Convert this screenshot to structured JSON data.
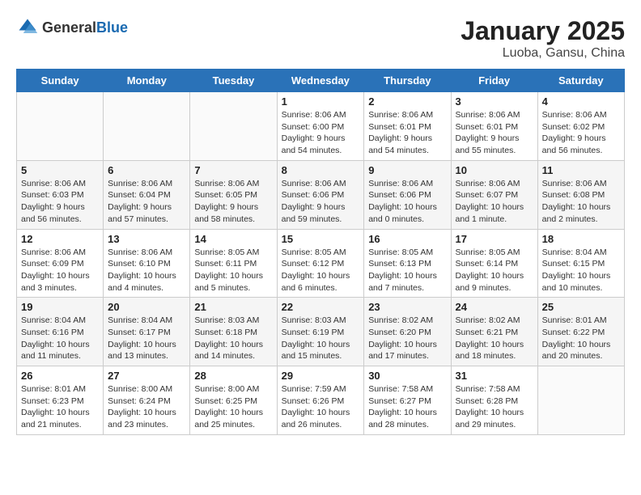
{
  "header": {
    "logo_general": "General",
    "logo_blue": "Blue",
    "month": "January 2025",
    "location": "Luoba, Gansu, China"
  },
  "days_of_week": [
    "Sunday",
    "Monday",
    "Tuesday",
    "Wednesday",
    "Thursday",
    "Friday",
    "Saturday"
  ],
  "weeks": [
    {
      "days": [
        {
          "number": "",
          "empty": true
        },
        {
          "number": "",
          "empty": true
        },
        {
          "number": "",
          "empty": true
        },
        {
          "number": "1",
          "sunrise": "8:06 AM",
          "sunset": "6:00 PM",
          "daylight": "9 hours and 54 minutes."
        },
        {
          "number": "2",
          "sunrise": "8:06 AM",
          "sunset": "6:01 PM",
          "daylight": "9 hours and 54 minutes."
        },
        {
          "number": "3",
          "sunrise": "8:06 AM",
          "sunset": "6:01 PM",
          "daylight": "9 hours and 55 minutes."
        },
        {
          "number": "4",
          "sunrise": "8:06 AM",
          "sunset": "6:02 PM",
          "daylight": "9 hours and 56 minutes."
        }
      ]
    },
    {
      "days": [
        {
          "number": "5",
          "sunrise": "8:06 AM",
          "sunset": "6:03 PM",
          "daylight": "9 hours and 56 minutes."
        },
        {
          "number": "6",
          "sunrise": "8:06 AM",
          "sunset": "6:04 PM",
          "daylight": "9 hours and 57 minutes."
        },
        {
          "number": "7",
          "sunrise": "8:06 AM",
          "sunset": "6:05 PM",
          "daylight": "9 hours and 58 minutes."
        },
        {
          "number": "8",
          "sunrise": "8:06 AM",
          "sunset": "6:06 PM",
          "daylight": "9 hours and 59 minutes."
        },
        {
          "number": "9",
          "sunrise": "8:06 AM",
          "sunset": "6:06 PM",
          "daylight": "10 hours and 0 minutes."
        },
        {
          "number": "10",
          "sunrise": "8:06 AM",
          "sunset": "6:07 PM",
          "daylight": "10 hours and 1 minute."
        },
        {
          "number": "11",
          "sunrise": "8:06 AM",
          "sunset": "6:08 PM",
          "daylight": "10 hours and 2 minutes."
        }
      ]
    },
    {
      "days": [
        {
          "number": "12",
          "sunrise": "8:06 AM",
          "sunset": "6:09 PM",
          "daylight": "10 hours and 3 minutes."
        },
        {
          "number": "13",
          "sunrise": "8:06 AM",
          "sunset": "6:10 PM",
          "daylight": "10 hours and 4 minutes."
        },
        {
          "number": "14",
          "sunrise": "8:05 AM",
          "sunset": "6:11 PM",
          "daylight": "10 hours and 5 minutes."
        },
        {
          "number": "15",
          "sunrise": "8:05 AM",
          "sunset": "6:12 PM",
          "daylight": "10 hours and 6 minutes."
        },
        {
          "number": "16",
          "sunrise": "8:05 AM",
          "sunset": "6:13 PM",
          "daylight": "10 hours and 7 minutes."
        },
        {
          "number": "17",
          "sunrise": "8:05 AM",
          "sunset": "6:14 PM",
          "daylight": "10 hours and 9 minutes."
        },
        {
          "number": "18",
          "sunrise": "8:04 AM",
          "sunset": "6:15 PM",
          "daylight": "10 hours and 10 minutes."
        }
      ]
    },
    {
      "days": [
        {
          "number": "19",
          "sunrise": "8:04 AM",
          "sunset": "6:16 PM",
          "daylight": "10 hours and 11 minutes."
        },
        {
          "number": "20",
          "sunrise": "8:04 AM",
          "sunset": "6:17 PM",
          "daylight": "10 hours and 13 minutes."
        },
        {
          "number": "21",
          "sunrise": "8:03 AM",
          "sunset": "6:18 PM",
          "daylight": "10 hours and 14 minutes."
        },
        {
          "number": "22",
          "sunrise": "8:03 AM",
          "sunset": "6:19 PM",
          "daylight": "10 hours and 15 minutes."
        },
        {
          "number": "23",
          "sunrise": "8:02 AM",
          "sunset": "6:20 PM",
          "daylight": "10 hours and 17 minutes."
        },
        {
          "number": "24",
          "sunrise": "8:02 AM",
          "sunset": "6:21 PM",
          "daylight": "10 hours and 18 minutes."
        },
        {
          "number": "25",
          "sunrise": "8:01 AM",
          "sunset": "6:22 PM",
          "daylight": "10 hours and 20 minutes."
        }
      ]
    },
    {
      "days": [
        {
          "number": "26",
          "sunrise": "8:01 AM",
          "sunset": "6:23 PM",
          "daylight": "10 hours and 21 minutes."
        },
        {
          "number": "27",
          "sunrise": "8:00 AM",
          "sunset": "6:24 PM",
          "daylight": "10 hours and 23 minutes."
        },
        {
          "number": "28",
          "sunrise": "8:00 AM",
          "sunset": "6:25 PM",
          "daylight": "10 hours and 25 minutes."
        },
        {
          "number": "29",
          "sunrise": "7:59 AM",
          "sunset": "6:26 PM",
          "daylight": "10 hours and 26 minutes."
        },
        {
          "number": "30",
          "sunrise": "7:58 AM",
          "sunset": "6:27 PM",
          "daylight": "10 hours and 28 minutes."
        },
        {
          "number": "31",
          "sunrise": "7:58 AM",
          "sunset": "6:28 PM",
          "daylight": "10 hours and 29 minutes."
        },
        {
          "number": "",
          "empty": true
        }
      ]
    }
  ],
  "labels": {
    "sunrise": "Sunrise:",
    "sunset": "Sunset:",
    "daylight": "Daylight:"
  }
}
